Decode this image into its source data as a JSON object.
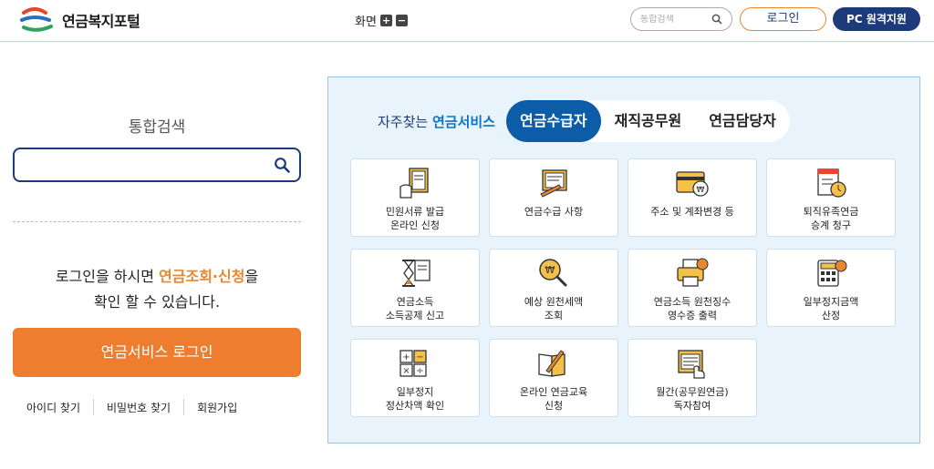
{
  "header": {
    "logo_text": "연금복지포털",
    "zoom_label": "화면",
    "zoom_in": "+",
    "zoom_out": "−",
    "search_placeholder": "통합검색",
    "login_label": "로그인",
    "remote_label": "PC 원격지원"
  },
  "left": {
    "title": "통합검색",
    "search_value": "",
    "msg_pre": "로그인을 하시면 ",
    "msg_highlight": "연금조회·신청",
    "msg_post": "을",
    "msg_line2": "확인 할 수 있습니다.",
    "service_login": "연금서비스 로그인",
    "links": [
      "아이디 찾기",
      "비밀번호 찾기",
      "회원가입"
    ]
  },
  "panel": {
    "intro_pre": "자주찾는 ",
    "intro_bold": "연금서비스",
    "tabs": [
      {
        "label": "연금수급자",
        "active": true
      },
      {
        "label": "재직공무원",
        "active": false
      },
      {
        "label": "연금담당자",
        "active": false
      }
    ],
    "cards": [
      {
        "label": "민원서류 발급\n온라인 신청",
        "icon": "document-hand-icon"
      },
      {
        "label": "연금수급 사항",
        "icon": "document-pen-icon"
      },
      {
        "label": "주소 및 계좌변경 등",
        "icon": "card-coin-icon"
      },
      {
        "label": "퇴직유족연금\n승계 청구",
        "icon": "checklist-clock-icon"
      },
      {
        "label": "연금소득\n소득공제 신고",
        "icon": "hourglass-icon"
      },
      {
        "label": "예상 원천세액\n조회",
        "icon": "coin-search-icon"
      },
      {
        "label": "연금소득 원천징수\n영수증 출력",
        "icon": "printer-icon"
      },
      {
        "label": "일부정지금액\n산정",
        "icon": "calculator-icon"
      },
      {
        "label": "일부정지\n정산차액 확인",
        "icon": "math-symbols-icon"
      },
      {
        "label": "온라인 연금교육\n신청",
        "icon": "book-pen-icon"
      },
      {
        "label": "월간(공무원연금)\n독자참여",
        "icon": "magazine-hand-icon"
      }
    ]
  },
  "colors": {
    "accent_orange": "#ee7d30",
    "navy": "#1d3a7a",
    "tab_active": "#0c5ca8",
    "panel_bg": "#e8f3fb"
  }
}
